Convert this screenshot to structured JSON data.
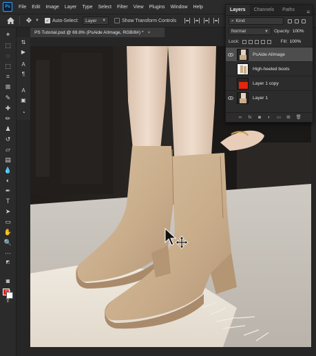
{
  "menubar": {
    "app_icon": "photoshop-logo",
    "app_icon_text": "Ps",
    "items": [
      "File",
      "Edit",
      "Image",
      "Layer",
      "Type",
      "Select",
      "Filter",
      "View",
      "Plugins",
      "Window",
      "Help"
    ]
  },
  "options": {
    "auto_select_label": "Auto-Select:",
    "auto_select_checked": true,
    "target_value": "Layer",
    "show_transform_label": "Show Transform Controls",
    "show_transform_checked": false
  },
  "document": {
    "tab_title": "PS Tutorial.psd @ 69.8% (PsAide AIImage, RGB/8#) *"
  },
  "layers_panel": {
    "tabs": [
      "Layers",
      "Channels",
      "Paths"
    ],
    "active_tab": "Layers",
    "kind_label": "Kind",
    "blend_mode": "Normal",
    "opacity_label": "Opacity:",
    "opacity_value": "100%",
    "lock_label": "Lock:",
    "fill_label": "Fill:",
    "fill_value": "100%",
    "layers": [
      {
        "name": "PsAide AIImage",
        "visible": true,
        "selected": true,
        "thumb": "photo"
      },
      {
        "name": "High-heeled boots",
        "visible": false,
        "selected": false,
        "thumb": "boots"
      },
      {
        "name": "Layer 1 copy",
        "visible": false,
        "selected": false,
        "thumb": "red"
      },
      {
        "name": "Layer 1",
        "visible": true,
        "selected": false,
        "thumb": "photo"
      }
    ],
    "footer_icons": [
      "link-icon",
      "fx-icon",
      "mask-icon",
      "adjustment-icon",
      "group-icon",
      "new-layer-icon",
      "trash-icon"
    ]
  },
  "colors": {
    "foreground": "#e8240c",
    "background": "#ffffff",
    "accent": "#31a8ff"
  }
}
